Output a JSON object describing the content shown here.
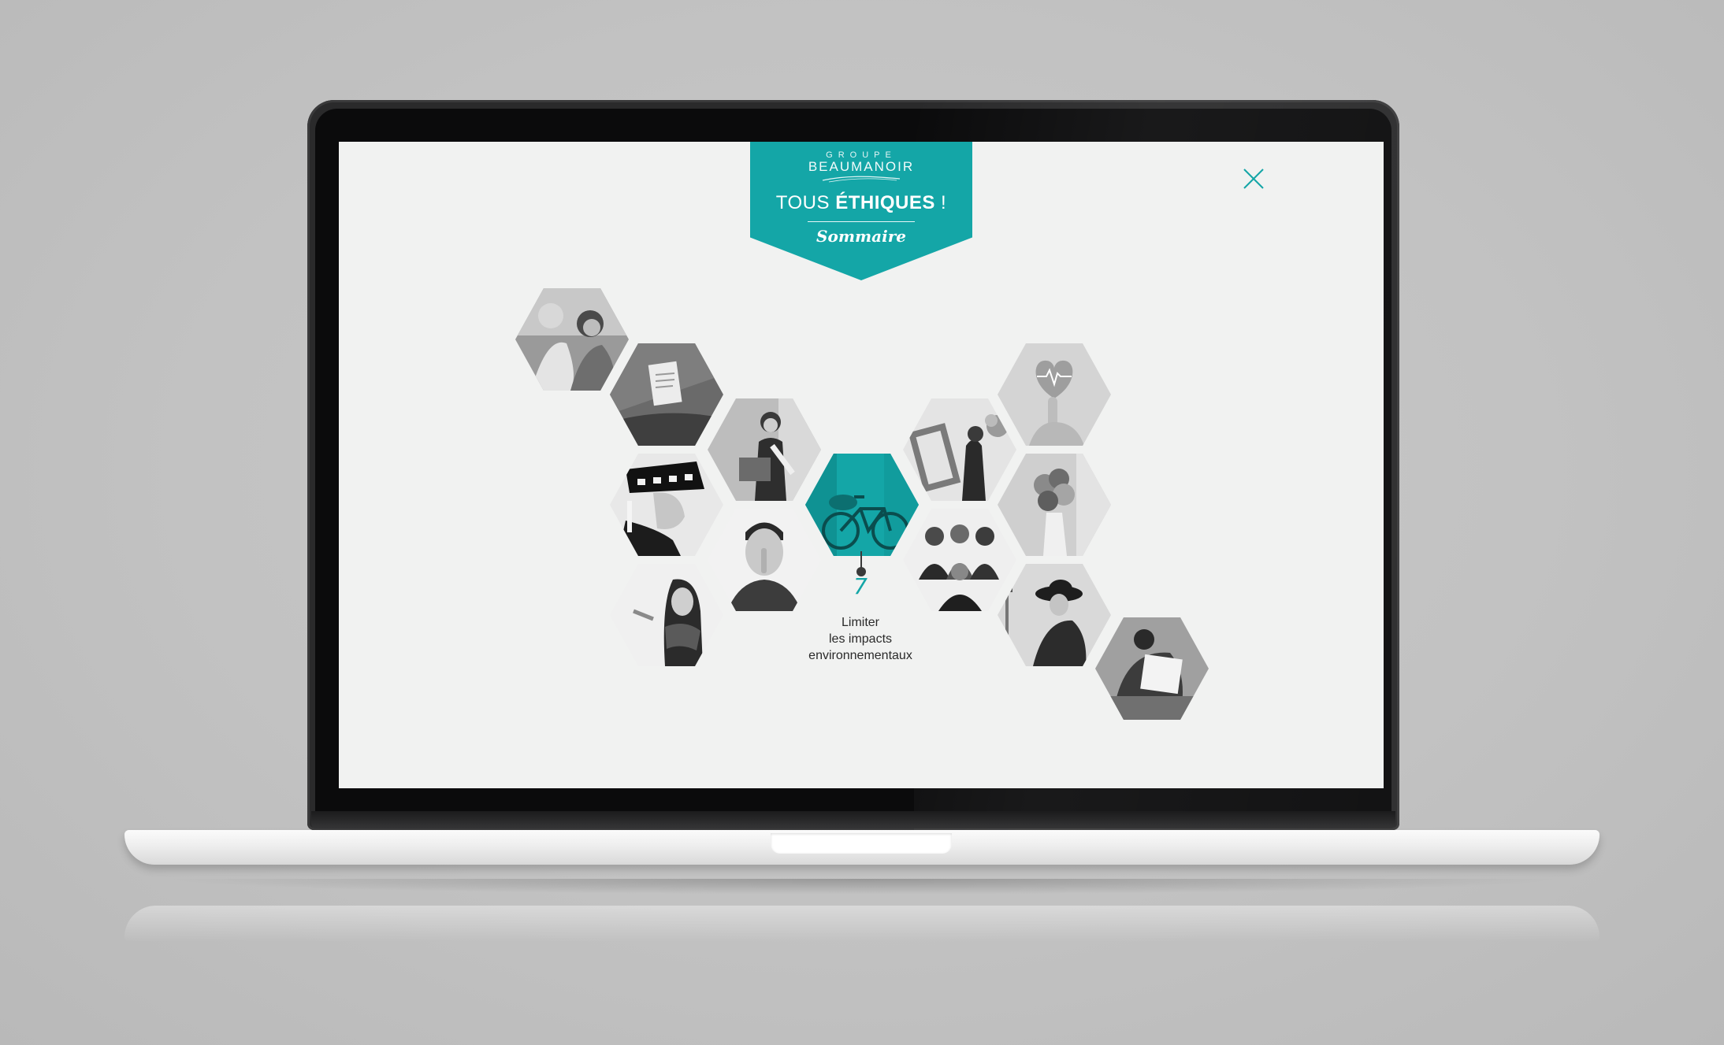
{
  "banner": {
    "group_small": "GROUPE",
    "brand": "BEAUMANOIR",
    "headline_light": "TOUS ",
    "headline_bold": "ÉTHIQUES",
    "headline_end": " !",
    "subtitle": "Sommaire"
  },
  "close_icon": "close-icon",
  "selected_item": {
    "number": "7",
    "caption_lines": [
      "Limiter",
      "les impacts",
      "environnementaux"
    ]
  },
  "hexagon_photos": [
    "smiling-women-photo",
    "clothing-label-photo",
    "woman-with-suitcase-photo",
    "police-officer-photo",
    "man-finger-on-lips-photo",
    "woman-with-scarf-photo",
    "bicycle-photo",
    "mirror-and-flowers-photo",
    "heart-pulse-finger-photo",
    "group-of-friends-photo",
    "flower-bouquet-photo",
    "woman-in-hat-city-photo",
    "man-with-box-photo"
  ],
  "colors": {
    "accent": "#14a6a7",
    "screen_bg": "#f1f2f1",
    "text_dark": "#2a2a2a"
  }
}
